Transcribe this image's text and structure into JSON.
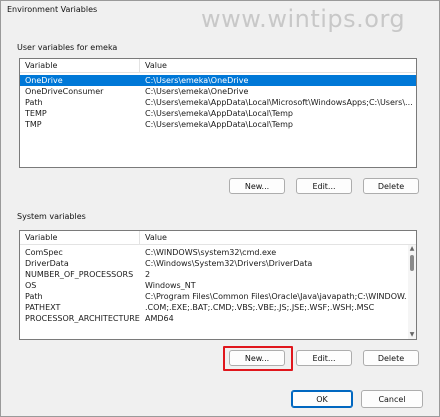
{
  "window": {
    "title": "Environment Variables"
  },
  "watermark": "www.wintips.org",
  "user_vars": {
    "label": "User variables for emeka",
    "headers": [
      "Variable",
      "Value"
    ],
    "rows": [
      [
        "OneDrive",
        "C:\\Users\\emeka\\OneDrive"
      ],
      [
        "OneDriveConsumer",
        "C:\\Users\\emeka\\OneDrive"
      ],
      [
        "Path",
        "C:\\Users\\emeka\\AppData\\Local\\Microsoft\\WindowsApps;C:\\Users\\..."
      ],
      [
        "TEMP",
        "C:\\Users\\emeka\\AppData\\Local\\Temp"
      ],
      [
        "TMP",
        "C:\\Users\\emeka\\AppData\\Local\\Temp"
      ]
    ],
    "selected_row": "OneDrive",
    "buttons": {
      "new": "New...",
      "edit": "Edit...",
      "delete": "Delete"
    }
  },
  "system_vars": {
    "label": "System variables",
    "headers": [
      "Variable",
      "Value"
    ],
    "rows": [
      [
        "ComSpec",
        "C:\\WINDOWS\\system32\\cmd.exe"
      ],
      [
        "DriverData",
        "C:\\Windows\\System32\\Drivers\\DriverData"
      ],
      [
        "NUMBER_OF_PROCESSORS",
        "2"
      ],
      [
        "OS",
        "Windows_NT"
      ],
      [
        "Path",
        "C:\\Program Files\\Common Files\\Oracle\\Java\\javapath;C:\\WINDOW..."
      ],
      [
        "PATHEXT",
        ".COM;.EXE;.BAT;.CMD;.VBS;.VBE;.JS;.JSE;.WSF;.WSH;.MSC"
      ],
      [
        "PROCESSOR_ARCHITECTURE",
        "AMD64"
      ]
    ],
    "buttons": {
      "new": "New...",
      "edit": "Edit...",
      "delete": "Delete"
    }
  },
  "footer": {
    "ok": "OK",
    "cancel": "Cancel"
  },
  "colors": {
    "selection": "#0078d7",
    "highlight": "#e0161c"
  }
}
